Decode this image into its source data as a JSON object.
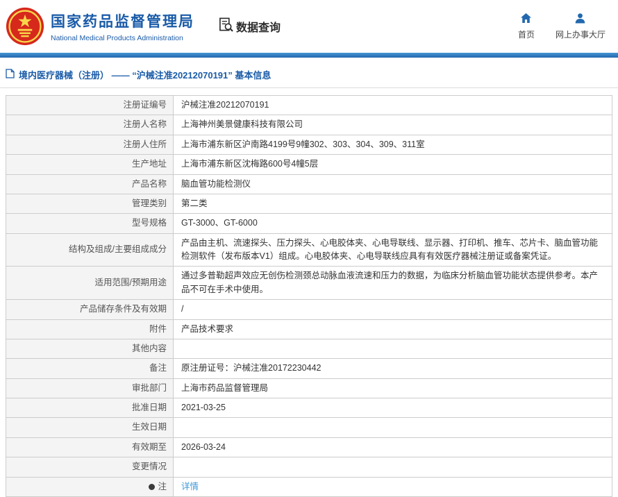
{
  "colors": {
    "brand_blue": "#1a5ba8",
    "bar_blue": "#2268ae",
    "link_blue": "#3d9ad6",
    "emblem_red": "#d7281c",
    "emblem_gold": "#f8d64a"
  },
  "header": {
    "org_name_zh": "国家药品监督管理局",
    "org_name_en": "National Medical Products Administration",
    "nav_data_query": "数据查询",
    "nav_home": "首页",
    "nav_online_hall": "网上办事大厅"
  },
  "breadcrumb": {
    "text": "境内医疗器械（注册） ——  “沪械注准20212070191”  基本信息"
  },
  "table": {
    "rows": [
      {
        "label": "注册证编号",
        "value": "沪械注准20212070191"
      },
      {
        "label": "注册人名称",
        "value": "上海神州美景健康科技有限公司"
      },
      {
        "label": "注册人住所",
        "value": "上海市浦东新区沪南路4199号9幢302、303、304、309、311室"
      },
      {
        "label": "生产地址",
        "value": "上海市浦东新区沈梅路600号4幢5层"
      },
      {
        "label": "产品名称",
        "value": "脑血管功能检测仪"
      },
      {
        "label": "管理类别",
        "value": "第二类"
      },
      {
        "label": "型号规格",
        "value": "GT-3000、GT-6000"
      },
      {
        "label": "结构及组成/主要组成成分",
        "value": "产品由主机、流速探头、压力探头、心电胶体夹、心电导联线、显示器、打印机、推车、芯片卡、脑血管功能检测软件（发布版本V1）组成。心电胶体夹、心电导联线应具有有效医疗器械注册证或备案凭证。"
      },
      {
        "label": "适用范围/预期用途",
        "value": "通过多普勒超声效应无创伤检测颈总动脉血液流速和压力的数据，为临床分析脑血管功能状态提供参考。本产品不可在手术中使用。"
      },
      {
        "label": "产品储存条件及有效期",
        "value": "/"
      },
      {
        "label": "附件",
        "value": "产品技术要求"
      },
      {
        "label": "其他内容",
        "value": ""
      },
      {
        "label": "备注",
        "value": "原注册证号：沪械注准20172230442"
      },
      {
        "label": "审批部门",
        "value": "上海市药品监督管理局"
      },
      {
        "label": "批准日期",
        "value": "2021-03-25"
      },
      {
        "label": "生效日期",
        "value": ""
      },
      {
        "label": "有效期至",
        "value": "2026-03-24"
      },
      {
        "label": "变更情况",
        "value": ""
      },
      {
        "label": "注",
        "value": "详情",
        "link": true,
        "label_icon": true
      }
    ]
  }
}
